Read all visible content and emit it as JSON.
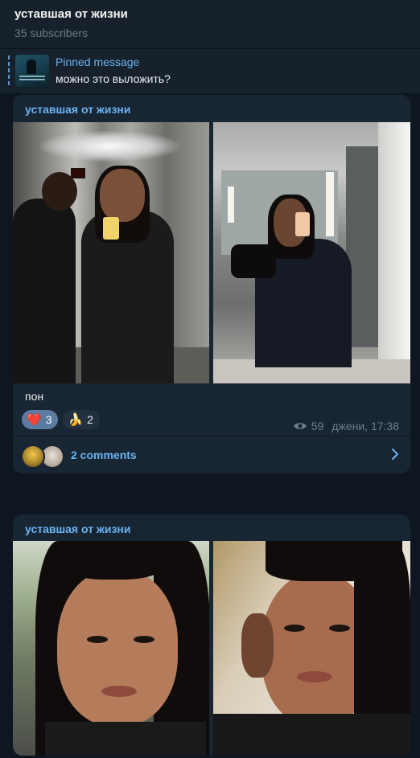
{
  "header": {
    "title": "уставшая от жизни",
    "subscribers": "35 subscribers"
  },
  "pinned": {
    "title": "Pinned message",
    "text": "можно это выложить?"
  },
  "posts": [
    {
      "author": "уставшая от жизни",
      "caption": "пон",
      "reactions": [
        {
          "emoji": "❤️",
          "count": "3",
          "chosen": true
        },
        {
          "emoji": "🍌",
          "count": "2",
          "chosen": false
        }
      ],
      "views": "59",
      "signature_time": "джени, 17:38",
      "comments_label": "2 comments"
    },
    {
      "author": "уставшая от жизни"
    }
  ],
  "icons": {
    "views": "eye-icon",
    "comments_arrow": "chevron-right-icon"
  },
  "colors": {
    "background": "#0e1621",
    "panel": "#17212b",
    "bubble": "#182533",
    "accent": "#6ab3f3",
    "muted": "#6d7f8f"
  }
}
